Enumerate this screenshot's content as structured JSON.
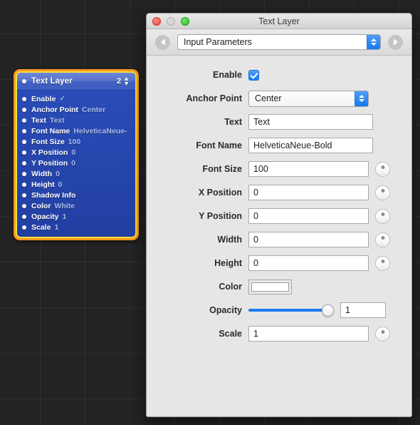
{
  "canvas": {
    "background_color": "#232323",
    "grid_color": "#2f2f2f"
  },
  "patch_node": {
    "title": "Text Layer",
    "count": "2",
    "selection_border_color": "#ff9a1e",
    "selection_inner_color": "#f7e03a",
    "node_color": "#2a4cb8",
    "ports": [
      {
        "label": "Enable",
        "value": "",
        "checked": "✓"
      },
      {
        "label": "Anchor Point",
        "value": "Center",
        "checked": ""
      },
      {
        "label": "Text",
        "value": "Text",
        "checked": ""
      },
      {
        "label": "Font Name",
        "value": "HelveticaNeue-",
        "checked": ""
      },
      {
        "label": "Font Size",
        "value": "100",
        "checked": ""
      },
      {
        "label": "X Position",
        "value": "0",
        "checked": ""
      },
      {
        "label": "Y Position",
        "value": "0",
        "checked": ""
      },
      {
        "label": "Width",
        "value": "0",
        "checked": ""
      },
      {
        "label": "Height",
        "value": "0",
        "checked": ""
      },
      {
        "label": "Shadow Info",
        "value": "",
        "checked": ""
      },
      {
        "label": "Color",
        "value": "White",
        "checked": ""
      },
      {
        "label": "Opacity",
        "value": "1",
        "checked": ""
      },
      {
        "label": "Scale",
        "value": "1",
        "checked": ""
      }
    ]
  },
  "inspector": {
    "window_title": "Text Layer",
    "traffic_lights": {
      "close": "close-button",
      "minimize": "minimize-button",
      "maximize": "maximize-button"
    },
    "toolbar": {
      "back_label": "Back",
      "forward_label": "Forward",
      "popup_selected": "Input Parameters",
      "popup_options": [
        "Input Parameters"
      ]
    },
    "fields": {
      "enable": {
        "label": "Enable",
        "checked": true
      },
      "anchor_point": {
        "label": "Anchor Point",
        "value": "Center",
        "options": [
          "Center"
        ]
      },
      "text": {
        "label": "Text",
        "value": "Text"
      },
      "font_name": {
        "label": "Font Name",
        "value": "HelveticaNeue-Bold"
      },
      "font_size": {
        "label": "Font Size",
        "value": "100"
      },
      "x_position": {
        "label": "X Position",
        "value": "0"
      },
      "y_position": {
        "label": "Y Position",
        "value": "0"
      },
      "width": {
        "label": "Width",
        "value": "0"
      },
      "height": {
        "label": "Height",
        "value": "0"
      },
      "color": {
        "label": "Color",
        "swatch": "#ffffff"
      },
      "opacity": {
        "label": "Opacity",
        "value": "1",
        "slider_percent": 100
      },
      "scale": {
        "label": "Scale",
        "value": "1"
      }
    }
  }
}
